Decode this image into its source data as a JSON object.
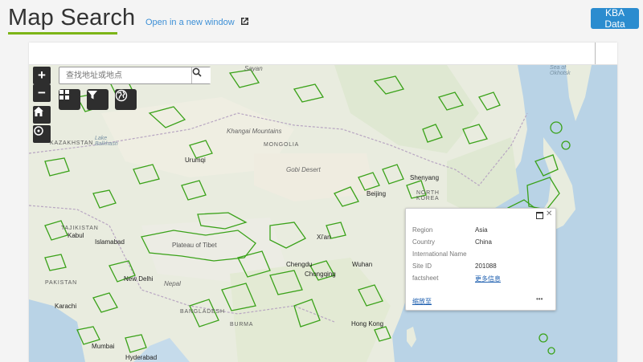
{
  "header": {
    "title": "Map Search",
    "open_link_label": "Open in a new window",
    "kba_button_label": "KBA Data"
  },
  "map": {
    "search": {
      "placeholder": "查找地址或地点"
    },
    "controls": {
      "zoom_in_label": "+",
      "zoom_out_label": "−"
    },
    "labels": {
      "kazakhstan": "KAZAKHSTAN",
      "mongolia": "MONGOLIA",
      "tajikistan": "TAJIKISTAN",
      "pakistan": "PAKISTAN",
      "bangladesh": "BANGLADESH",
      "burma": "BURMA",
      "north_korea": "NORTH\nKOREA",
      "plateau_of_tibet": "Plateau of Tibet",
      "gobi_desert": "Gobi Desert",
      "khangai_mountains": "Khangai Mountains",
      "lake_balkhash": "Lake\nBalkhash",
      "sea_of_okhotsk": "Sea of\nOkhotsk",
      "urumqi": "Urumqi",
      "beijing": "Beijing",
      "shenyang": "Shenyang",
      "xian": "Xi'an",
      "chengdu": "Chengdu",
      "chongqing": "Chongqing",
      "wuhan": "Wuhan",
      "kabul": "Kabul",
      "islamabad": "Islamabad",
      "new_delhi": "New Delhi",
      "karachi": "Karachi",
      "mumbai": "Mumbai",
      "hyderabad": "Hyderabad",
      "hong_kong": "Hong Kong",
      "sayan": "Sayan",
      "nepal": "Nepal"
    },
    "colors": {
      "land": "#e8ecde",
      "water": "#b9d3e6",
      "kba_outline": "#3aa219",
      "boundary": "#b8a6c2"
    }
  },
  "popup": {
    "fields": [
      {
        "label": "Region",
        "value": "Asia"
      },
      {
        "label": "Country",
        "value": "China"
      },
      {
        "label": "International Name",
        "value": ""
      },
      {
        "label": "Site ID",
        "value": "201088"
      },
      {
        "label": "factsheet",
        "value": "更多信息"
      }
    ],
    "zoom_to_label": "缩放至",
    "more_label": "•••"
  }
}
